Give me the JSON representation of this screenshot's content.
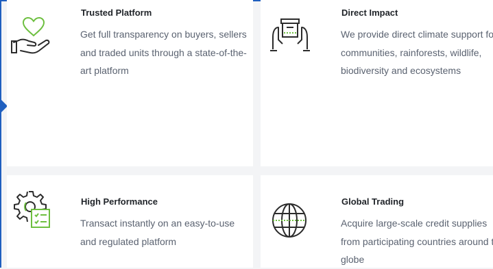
{
  "features": [
    {
      "title": "Trusted Platform",
      "description": "Get full transparency on buyers, sellers and traded units through a state-of-the-art platform",
      "icon": "heart-hand-icon"
    },
    {
      "title": "Direct Impact",
      "description": "We provide direct climate support for communities, rainforests, wildlife, biodiversity and ecosystems",
      "icon": "box-hands-icon"
    },
    {
      "title": "High Performance",
      "description": "Transact instantly on an easy-to-use and regulated platform",
      "icon": "gear-checklist-icon"
    },
    {
      "title": "Global Trading",
      "description": "Acquire large-scale credit supplies from participating countries around the globe",
      "icon": "globe-icon"
    }
  ],
  "colors": {
    "accent": "#6dbf3f",
    "icon_stroke": "#2b2b2b",
    "frame": "#1f5fbf"
  }
}
